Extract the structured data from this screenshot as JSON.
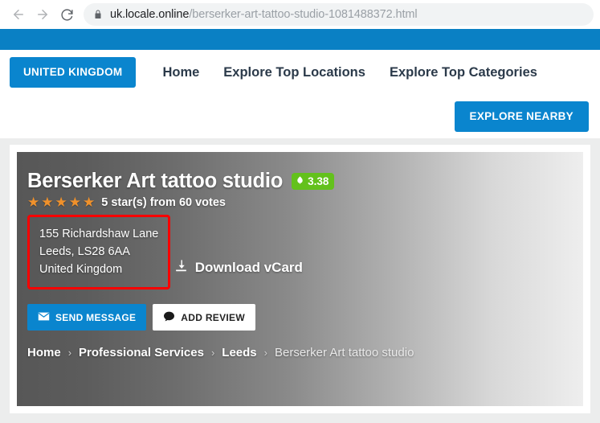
{
  "browser": {
    "back_icon": "arrow-left-icon",
    "forward_icon": "arrow-right-icon",
    "reload_icon": "reload-icon",
    "lock_icon": "lock-icon",
    "url_domain": "uk.locale.online",
    "url_path": "/berserker-art-tattoo-studio-1081488372.html"
  },
  "site_nav": {
    "country_button": "UNITED KINGDOM",
    "links": [
      {
        "label": "Home"
      },
      {
        "label": "Explore Top Locations"
      },
      {
        "label": "Explore Top Categories"
      }
    ],
    "explore_nearby_button": "EXPLORE NEARBY"
  },
  "listing": {
    "title": "Berserker Art tattoo studio",
    "rating_badge": {
      "icon": "leaf-icon",
      "value": "3.38"
    },
    "stars": {
      "count": 5,
      "glyph": "★"
    },
    "votes_text": "5 star(s) from 60 votes",
    "address": [
      "155 Richardshaw Lane",
      "Leeds, LS28 6AA",
      "United Kingdom"
    ],
    "vcard": {
      "icon": "download-icon",
      "label": "Download vCard"
    },
    "actions": [
      {
        "label": "SEND MESSAGE",
        "icon": "envelope-icon"
      },
      {
        "label": "ADD REVIEW",
        "icon": "comment-icon"
      }
    ],
    "breadcrumb": {
      "items": [
        {
          "label": "Home"
        },
        {
          "label": "Professional Services"
        },
        {
          "label": "Leeds"
        }
      ],
      "separator": "›",
      "current": "Berserker Art tattoo studio"
    }
  },
  "colors": {
    "brand_blue": "#0a85ce",
    "topbar_blue": "#0a80c4",
    "badge_green": "#63c11c",
    "star_orange": "#f0912b",
    "highlight_red": "#f80000",
    "nav_text": "#2b3a4a"
  }
}
